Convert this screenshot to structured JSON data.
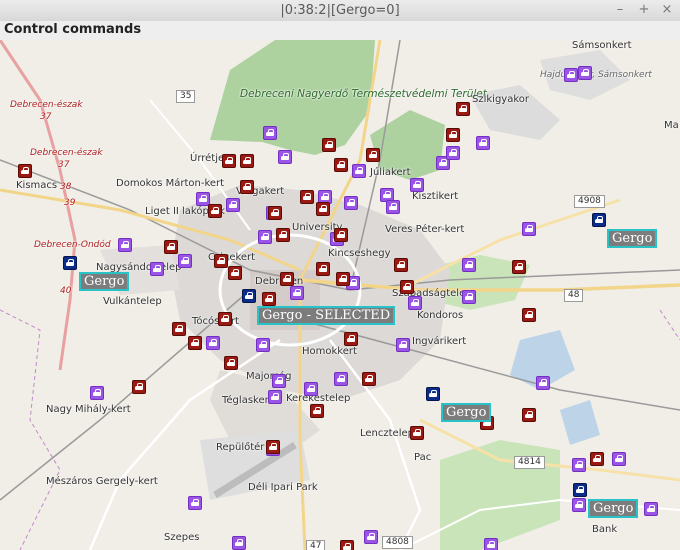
{
  "window": {
    "title": "|0:38:2|[Gergo=0]",
    "minimize": "–",
    "maximize": "+",
    "close": "×"
  },
  "menu": {
    "control_commands": "Control commands"
  },
  "map": {
    "places": {
      "debrecen_eszak": "Debrecen-észak",
      "debrecen_eszak2": "Debrecen-észak",
      "debrecen_ondod": "Debrecen-Ondód",
      "kismacs": "Kismacs",
      "domokos": "Domokos Márton-kert",
      "liget": "Liget II lakópark",
      "urretje": "Úrrétje",
      "vargakert": "Vargakert",
      "park": "Debreceni Nagyerdő Természetvédelmi Terület",
      "juliakert": "Júliakert",
      "kisztikert": "Kisztikert",
      "university": "University",
      "veres": "Veres Péter-kert",
      "kincsesegy": "Kincseshegy",
      "cigerkert": "Csigekert",
      "nagysandor": "Nagysándortelep",
      "debrecen": "Debrecen",
      "vulkantelep": "Vulkántelep",
      "toco": "Tócóskert",
      "szabadsag": "Szabadságtelep",
      "kondoros": "Kondoros",
      "homokkert": "Homokkert",
      "ingvar": "Ingvárikert",
      "majoros": "Majorság",
      "teglaskert": "Téglaskert",
      "kerekes": "Kerekestelep",
      "nagymihaly": "Nagy Mihály-kert",
      "lencztelep": "Lencztelep",
      "repuloter": "Repülőtér",
      "pac": "Pac",
      "meszaros": "Mészáros Gergely-kert",
      "deli": "Déli Ipari Park",
      "szepes": "Szepes",
      "szikigyakor": "Szikigyakor",
      "samsonkert": "Sámsonkert",
      "hajdu": "Hajdú-Bihar, Sámsonkert",
      "bank": "Bank",
      "ma": "Ma"
    },
    "roads": {
      "r35": "35",
      "r4908": "4908",
      "r48": "48",
      "r4814": "4814",
      "r4808": "4808",
      "r47": "47",
      "r37a": "37",
      "r37b": "37",
      "r38": "38",
      "r39": "39",
      "r40": "40"
    }
  },
  "vehicle_labels": {
    "v1": "Gergo",
    "v2": "Gergo - SELECTED",
    "v3": "Gergo",
    "v4": "Gergo",
    "v5": "Gergo"
  },
  "colors": {
    "purple_marker": "#9a55e6",
    "red_marker": "#9a1a12",
    "navy_vehicle": "#0c2c8c",
    "label_border": "#27c3c8",
    "label_bg": "#7c7c7c"
  }
}
